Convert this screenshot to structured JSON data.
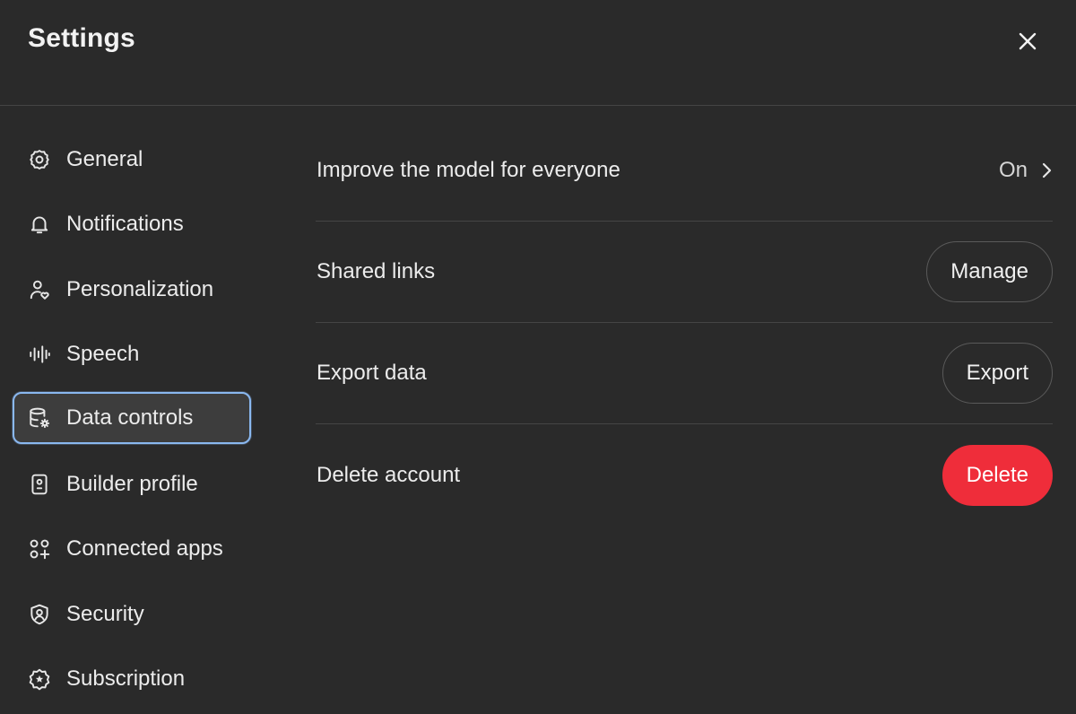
{
  "window": {
    "title": "Settings",
    "close_icon": "close-icon"
  },
  "sidebar": {
    "items": [
      {
        "label": "General",
        "icon": "gear-icon",
        "active": false
      },
      {
        "label": "Notifications",
        "icon": "bell-icon",
        "active": false
      },
      {
        "label": "Personalization",
        "icon": "person-heart-icon",
        "active": false
      },
      {
        "label": "Speech",
        "icon": "waveform-icon",
        "active": false
      },
      {
        "label": "Data controls",
        "icon": "database-gear-icon",
        "active": true
      },
      {
        "label": "Builder profile",
        "icon": "id-badge-icon",
        "active": false
      },
      {
        "label": "Connected apps",
        "icon": "apps-plus-icon",
        "active": false
      },
      {
        "label": "Security",
        "icon": "shield-user-icon",
        "active": false
      },
      {
        "label": "Subscription",
        "icon": "badge-star-icon",
        "active": false
      }
    ]
  },
  "content": {
    "improve_model": {
      "label": "Improve the model for everyone",
      "value": "On",
      "icon": "chevron-right-icon"
    },
    "shared_links": {
      "label": "Shared links",
      "button": "Manage"
    },
    "export_data": {
      "label": "Export data",
      "button": "Export"
    },
    "delete_account": {
      "label": "Delete account",
      "button": "Delete"
    }
  },
  "colors": {
    "background": "#2a2a2a",
    "active_outline": "#8ab8f0",
    "danger": "#ef2d3a"
  }
}
